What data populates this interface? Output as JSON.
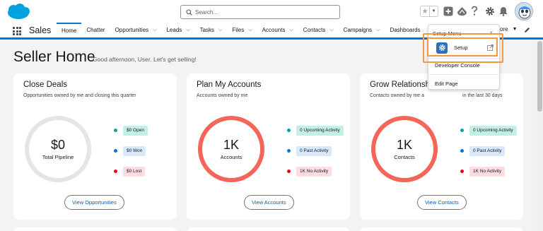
{
  "header": {
    "search_placeholder": "Search...",
    "icons": [
      "salesforce-cloud-logo",
      "search-icon",
      "star-icon",
      "chevron-down-icon",
      "plus-icon",
      "trailhead-icon",
      "help-icon",
      "gear-icon",
      "bell-icon",
      "avatar"
    ]
  },
  "nav": {
    "app_name": "Sales",
    "items": [
      {
        "label": "Home",
        "dropdown": false
      },
      {
        "label": "Chatter",
        "dropdown": false
      },
      {
        "label": "Opportunities",
        "dropdown": true
      },
      {
        "label": "Leads",
        "dropdown": true
      },
      {
        "label": "Tasks",
        "dropdown": true
      },
      {
        "label": "Files",
        "dropdown": true
      },
      {
        "label": "Accounts",
        "dropdown": true
      },
      {
        "label": "Contacts",
        "dropdown": true
      },
      {
        "label": "Campaigns",
        "dropdown": true
      },
      {
        "label": "Dashboards",
        "dropdown": false
      }
    ],
    "more_label": "ore"
  },
  "page": {
    "title": "Seller Home",
    "greeting": "Good afternoon, User. Let's get selling!"
  },
  "cards": [
    {
      "title": "Close Deals",
      "subtitle": "Opportunities owned by me and closing this quarter",
      "ring_value": "$0",
      "ring_label": "Total Pipeline",
      "legend": [
        {
          "text": "$0 Open",
          "dot": "#06a59a",
          "bg": "#c3f0e4"
        },
        {
          "text": "$0 Won",
          "dot": "#0176d3",
          "bg": "#d7e9fb"
        },
        {
          "text": "$0 Lost",
          "dot": "#ea001e",
          "bg": "#fddde0"
        }
      ],
      "button": "View Opportunities"
    },
    {
      "title": "Plan My Accounts",
      "subtitle": "Accounts owned by me",
      "ring_value": "1K",
      "ring_label": "Accounts",
      "legend": [
        {
          "text": "0 Upcoming Activity",
          "dot": "#06a59a",
          "bg": "#c3f0e4"
        },
        {
          "text": "0 Past Activity",
          "dot": "#0176d3",
          "bg": "#d7e9fb"
        },
        {
          "text": "1K No Activity",
          "dot": "#ea001e",
          "bg": "#fddde0"
        }
      ],
      "button": "View Accounts"
    },
    {
      "title": "Grow Relationsh",
      "subtitle": "Contacts owned by me a",
      "subtitle_tail": "in the last 30 days",
      "ring_value": "1K",
      "ring_label": "Contacts",
      "legend": [
        {
          "text": "0 Upcoming Activity",
          "dot": "#06a59a",
          "bg": "#c3f0e4"
        },
        {
          "text": "0 Past Activity",
          "dot": "#0176d3",
          "bg": "#d7e9fb"
        },
        {
          "text": "1K No Activity",
          "dot": "#ea001e",
          "bg": "#fddde0"
        }
      ],
      "button": "View Contacts"
    }
  ],
  "setup_menu": {
    "header": "Setup Menu",
    "close": "×",
    "setup_label": "Setup",
    "developer_console": "Developer Console",
    "edit_page": "Edit Page"
  },
  "colors": {
    "brand_blue": "#0176d3",
    "highlight": "#f59a3c",
    "ring_red": "#f4665a"
  }
}
